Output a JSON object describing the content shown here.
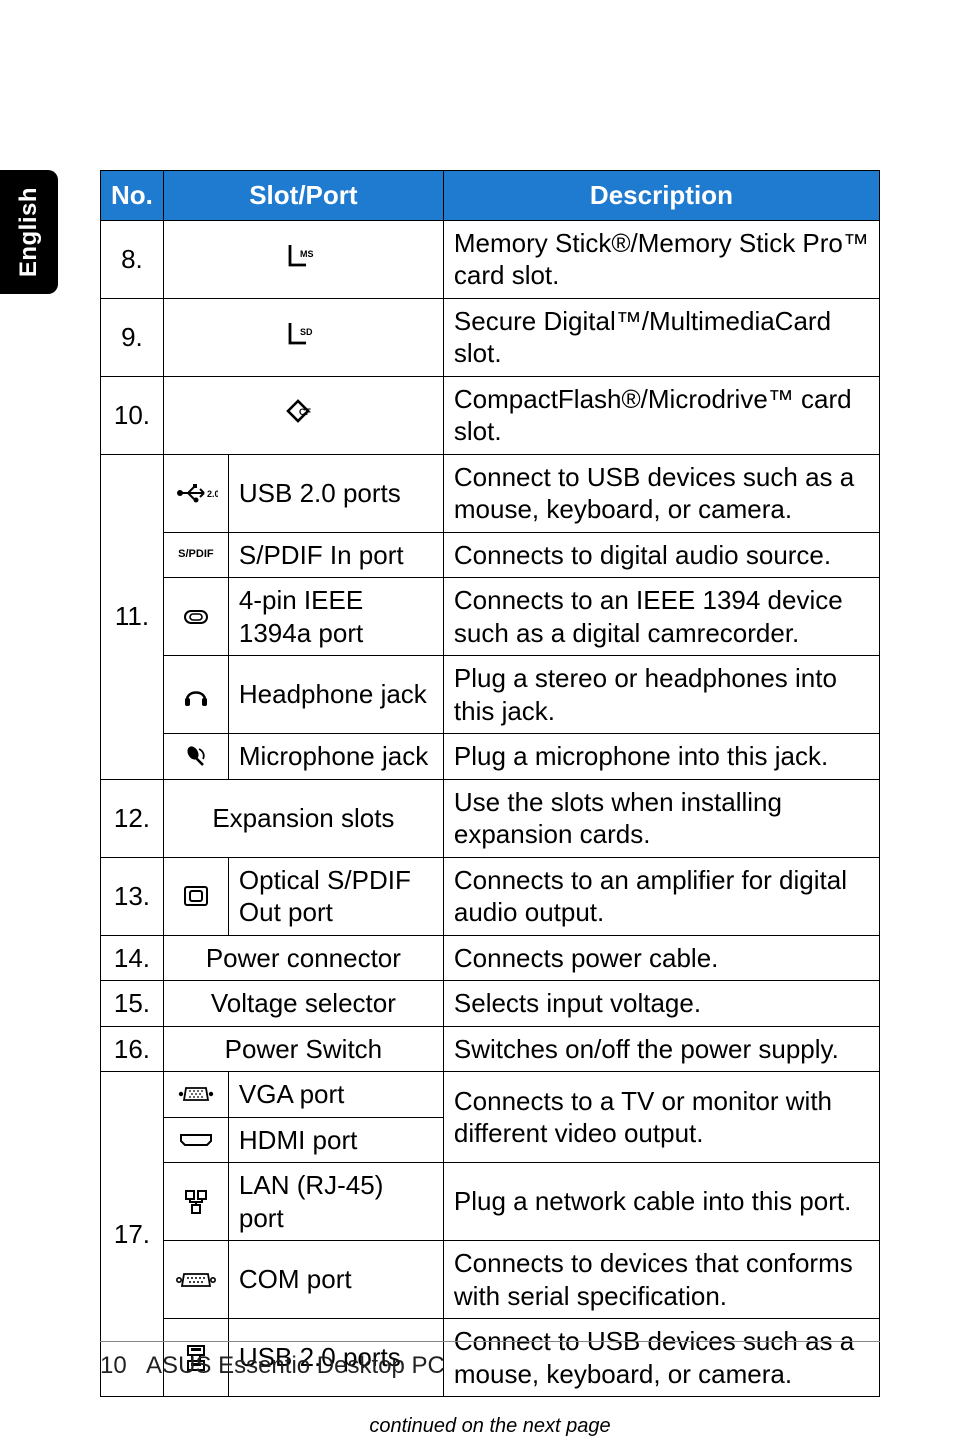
{
  "sidebar": {
    "label": "English"
  },
  "table": {
    "headers": {
      "no": "No.",
      "slot": "Slot/Port",
      "desc": "Description"
    },
    "rows": [
      {
        "no": "8.",
        "icon": "ms-icon",
        "name": "",
        "desc": "Memory Stick®/Memory Stick Pro™ card slot."
      },
      {
        "no": "9.",
        "icon": "sd-icon",
        "name": "",
        "desc": "Secure Digital™/MultimediaCard slot."
      },
      {
        "no": "10.",
        "icon": "cf-icon",
        "name": "",
        "desc": "CompactFlash®/Microdrive™ card slot."
      },
      {
        "no": "11.",
        "sub": [
          {
            "icon": "usb2-icon",
            "name": "USB 2.0 ports",
            "desc": "Connect to USB devices such as a mouse, keyboard, or camera."
          },
          {
            "icon": "spdif-icon",
            "name": "S/PDIF In port",
            "desc": "Connects to digital audio source."
          },
          {
            "icon": "ieee1394-icon",
            "name": "4-pin IEEE 1394a port",
            "desc": "Connects to an IEEE 1394 device such as a digital camrecorder."
          },
          {
            "icon": "headphone-icon",
            "name": "Headphone jack",
            "desc": "Plug a stereo or headphones into this jack."
          },
          {
            "icon": "mic-icon",
            "name": "Microphone jack",
            "desc": "Plug a microphone into this jack."
          }
        ]
      },
      {
        "no": "12.",
        "icon": "",
        "name": "Expansion slots",
        "desc": "Use the slots when installing expansion cards."
      },
      {
        "no": "13.",
        "icon": "optical-icon",
        "name": "Optical S/PDIF Out port",
        "desc": "Connects to an amplifier for digital audio output."
      },
      {
        "no": "14.",
        "icon": "",
        "name": "Power connector",
        "desc": "Connects power cable."
      },
      {
        "no": "15.",
        "icon": "",
        "name": "Voltage selector",
        "desc": "Selects input voltage."
      },
      {
        "no": "16.",
        "icon": "",
        "name": "Power Switch",
        "desc": "Switches on/off the power supply."
      },
      {
        "no": "17.",
        "sub": [
          {
            "icon": "vga-icon",
            "name": "VGA port",
            "desc": "Connects to a TV or monitor with different video output.",
            "merge_desc": 2
          },
          {
            "icon": "hdmi-icon",
            "name": "HDMI port"
          },
          {
            "icon": "lan-icon",
            "name": "LAN (RJ-45) port",
            "desc": "Plug a network cable into this port."
          },
          {
            "icon": "com-icon",
            "name": "COM port",
            "desc": "Connects to devices that conforms with serial specification."
          },
          {
            "icon": "usb-stack-icon",
            "name": "USB 2.0 ports",
            "desc": "Connect to USB devices such as a mouse, keyboard, or camera."
          }
        ]
      }
    ]
  },
  "continued": "continued on the next page",
  "footer": {
    "page": "10",
    "title": "ASUS Essentio Desktop PC"
  }
}
